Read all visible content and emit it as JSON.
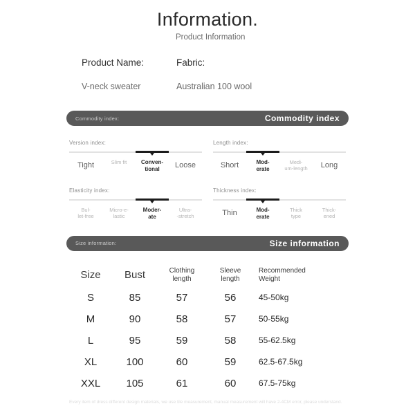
{
  "header": {
    "title": "Information.",
    "subtitle": "Product Information"
  },
  "product": {
    "name_label": "Product Name:",
    "name_value": "V-neck sweater",
    "fabric_label": "Fabric:",
    "fabric_value": "Australian 100 wool"
  },
  "commodity_banner": {
    "small_label": "Commodity index:",
    "big_label": "Commodity index"
  },
  "size_banner": {
    "small_label": "Size information:",
    "big_label": "Size information"
  },
  "indexes": [
    {
      "title": "Version index:",
      "active": 2,
      "options": [
        "Tight",
        "Slim fit",
        "Conven-\ntional",
        "Loose"
      ]
    },
    {
      "title": "Length index:",
      "active": 1,
      "options": [
        "Short",
        "Mod-\nerate",
        "Medi-\num-length",
        "Long"
      ]
    },
    {
      "title": "Elasticity index:",
      "active": 2,
      "options": [
        "Bul-\nlet-free",
        "Micro-e-\nlastic",
        "Moder-\nate",
        "Ultra-\n-stretch"
      ]
    },
    {
      "title": "Thickness index:",
      "active": 1,
      "options": [
        "Thin",
        "Mod-\nerate",
        "Thick\ntype",
        "Thick-\nened"
      ]
    }
  ],
  "size_table": {
    "headers": [
      "Size",
      "Bust",
      "Clothing\nlength",
      "Sleeve\nlength",
      "Recommended\nWeight"
    ],
    "rows": [
      [
        "S",
        "85",
        "57",
        "56",
        "45-50kg"
      ],
      [
        "M",
        "90",
        "58",
        "57",
        "50-55kg"
      ],
      [
        "L",
        "95",
        "59",
        "58",
        "55-62.5kg"
      ],
      [
        "XL",
        "100",
        "60",
        "59",
        "62.5-67.5kg"
      ],
      [
        "XXL",
        "105",
        "61",
        "60",
        "67.5-75kg"
      ]
    ]
  },
  "footer": {
    "disclaimer": "Every item of dress different design materials, we use tile measurement, manual measurement will have 2-4CM error, please understand."
  },
  "colors": {
    "banner_bg": "#595959",
    "active_segment": "#1c1c1c",
    "inactive_segment": "#e2e2e2",
    "page_bg": "#ffffff"
  }
}
